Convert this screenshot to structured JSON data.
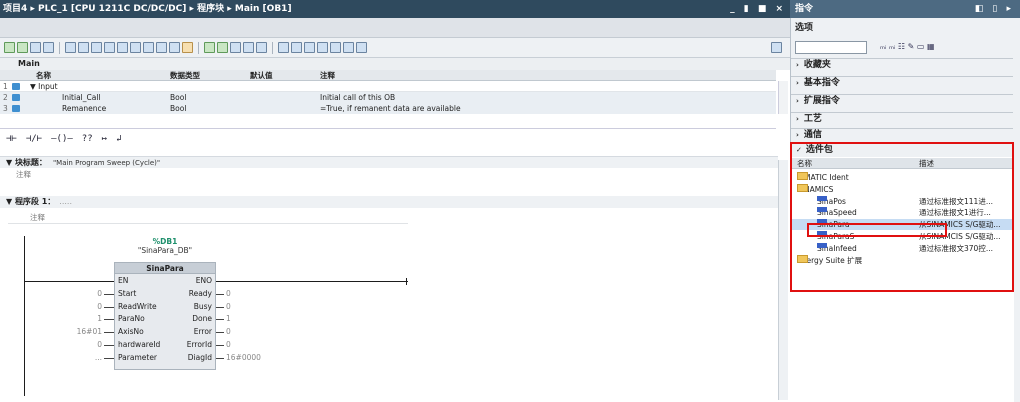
{
  "editor": {
    "breadcrumb": "项目4 ▸ PLC_1 [CPU 1211C DC/DC/DC] ▸ 程序块 ▸ Main [OB1]",
    "window_buttons": "_ ▮ ■ ×",
    "interface": {
      "title": "Main",
      "columns": {
        "name": "名称",
        "datatype": "数据类型",
        "default": "默认值",
        "comment": "注释"
      },
      "rows": [
        {
          "num": "1",
          "name": "▼ Input",
          "datatype": "",
          "comment": ""
        },
        {
          "num": "2",
          "name": "Initial_Call",
          "datatype": "Bool",
          "comment": "Initial call of this OB"
        },
        {
          "num": "3",
          "name": "Remanence",
          "datatype": "Bool",
          "comment": "=True, if remanent data are available"
        }
      ]
    },
    "ladder_tools": [
      "⊣⊢",
      "⊣/⊢",
      "–()–",
      "??",
      "↦",
      "↲"
    ],
    "block_title": {
      "label": "▼ 块标题：",
      "value": "\"Main Program Sweep (Cycle)\""
    },
    "comment_label": "注释",
    "segment": {
      "label": "▼   程序段 1：",
      "dots": "....."
    },
    "segment_comment": "注释",
    "fb": {
      "db_number": "%DB1",
      "db_instance": "\"SinaPara_DB\"",
      "name": "SinaPara",
      "left_pins": [
        {
          "name": "EN",
          "value": ""
        },
        {
          "name": "Start",
          "value": "0"
        },
        {
          "name": "ReadWrite",
          "value": "0"
        },
        {
          "name": "ParaNo",
          "value": "1"
        },
        {
          "name": "AxisNo",
          "value": "16#01"
        },
        {
          "name": "hardwareId",
          "value": "0"
        },
        {
          "name": "Parameter",
          "value": "..."
        }
      ],
      "right_pins": [
        {
          "name": "ENO",
          "value": ""
        },
        {
          "name": "Ready",
          "value": "0"
        },
        {
          "name": "Busy",
          "value": "0"
        },
        {
          "name": "Done",
          "value": "1"
        },
        {
          "name": "Error",
          "value": "0"
        },
        {
          "name": "ErrorId",
          "value": "0"
        },
        {
          "name": "DiagId",
          "value": "16#0000"
        }
      ]
    }
  },
  "taskcard": {
    "title": "指令",
    "title_buttons": "◧ ▯ ▸",
    "options": "选项",
    "search_tools": "ₘᵢ ₘᵢ ☷ ✎    ▭ ▦",
    "sections": [
      {
        "label": "收藏夹"
      },
      {
        "label": "基本指令"
      },
      {
        "label": "扩展指令"
      },
      {
        "label": "工艺"
      },
      {
        "label": "通信"
      }
    ],
    "package": {
      "title": "选件包",
      "col_name": "名称",
      "col_desc": "描述",
      "items": [
        {
          "name": "SIMATIC Ident",
          "desc": "",
          "kind": "folder",
          "indent": 0
        },
        {
          "name": "SINAMICS",
          "desc": "",
          "kind": "folder",
          "indent": 0
        },
        {
          "name": "SinaPos",
          "desc": "通过标准报文111进...",
          "kind": "fb",
          "indent": 1
        },
        {
          "name": "SinaSpeed",
          "desc": "通过标准报文1进行...",
          "kind": "fb",
          "indent": 1
        },
        {
          "name": "SinaPara",
          "desc": "从SINAMICS S/G驱动...",
          "kind": "fb",
          "indent": 1
        },
        {
          "name": "SinaParaS",
          "desc": "从SINAMCIS S/G驱动...",
          "kind": "fb",
          "indent": 1
        },
        {
          "name": "SinaInfeed",
          "desc": "通过标准报文370控...",
          "kind": "fb",
          "indent": 1
        },
        {
          "name": "Energy Suite 扩展",
          "desc": "",
          "kind": "folder",
          "indent": 0
        }
      ]
    }
  }
}
